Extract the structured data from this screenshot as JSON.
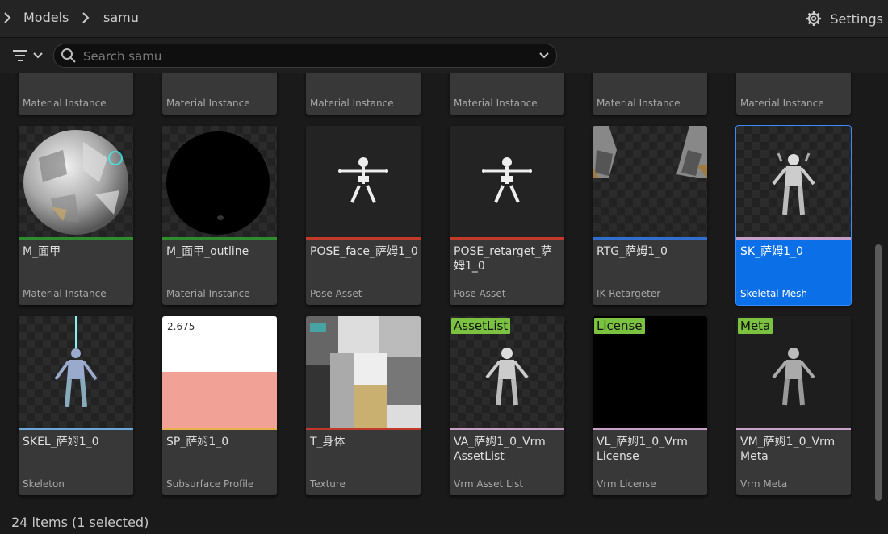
{
  "breadcrumb": {
    "root": "Models",
    "current": "samu"
  },
  "settings_label": "Settings",
  "search": {
    "placeholder": "Search samu"
  },
  "top_row_types": [
    "Material Instance",
    "Material Instance",
    "Material Instance",
    "Material Instance",
    "Material Instance",
    "Material Instance"
  ],
  "tiles": [
    {
      "name": "M_面甲",
      "type": "Material Instance"
    },
    {
      "name": "M_面甲_outline",
      "type": "Material Instance"
    },
    {
      "name": "POSE_face_萨姆1_0",
      "type": "Pose Asset"
    },
    {
      "name": "POSE_retarget_萨姆1_0",
      "type": "Pose Asset"
    },
    {
      "name": "RTG_萨姆1_0",
      "type": "IK Retargeter"
    },
    {
      "name": "SK_萨姆1_0",
      "type": "Skeletal Mesh"
    },
    {
      "name": "SKEL_萨姆1_0",
      "type": "Skeleton"
    },
    {
      "name": "SP_萨姆1_0",
      "type": "Subsurface Profile",
      "thumb_value": "2.675"
    },
    {
      "name": "T_身体",
      "type": "Texture"
    },
    {
      "name": "VA_萨姆1_0_Vrm AssetList",
      "type": "Vrm Asset List",
      "badge": "AssetList"
    },
    {
      "name": "VL_萨姆1_0_Vrm License",
      "type": "Vrm License",
      "badge": "License"
    },
    {
      "name": "VM_萨姆1_0_Vrm Meta",
      "type": "Vrm Meta",
      "badge": "Meta"
    }
  ],
  "status": "24 items (1 selected)",
  "colors": {
    "material": "#2e8b2e",
    "pose": "#c0392b",
    "retargeter": "#2f6fcf",
    "selected": "#0b6fe8",
    "skeleton": "#6aa8d8",
    "subsurface": "#e8b04a",
    "texture": "#c0392b",
    "vrm": "#c8a0c8",
    "badge": "#7cc241"
  }
}
